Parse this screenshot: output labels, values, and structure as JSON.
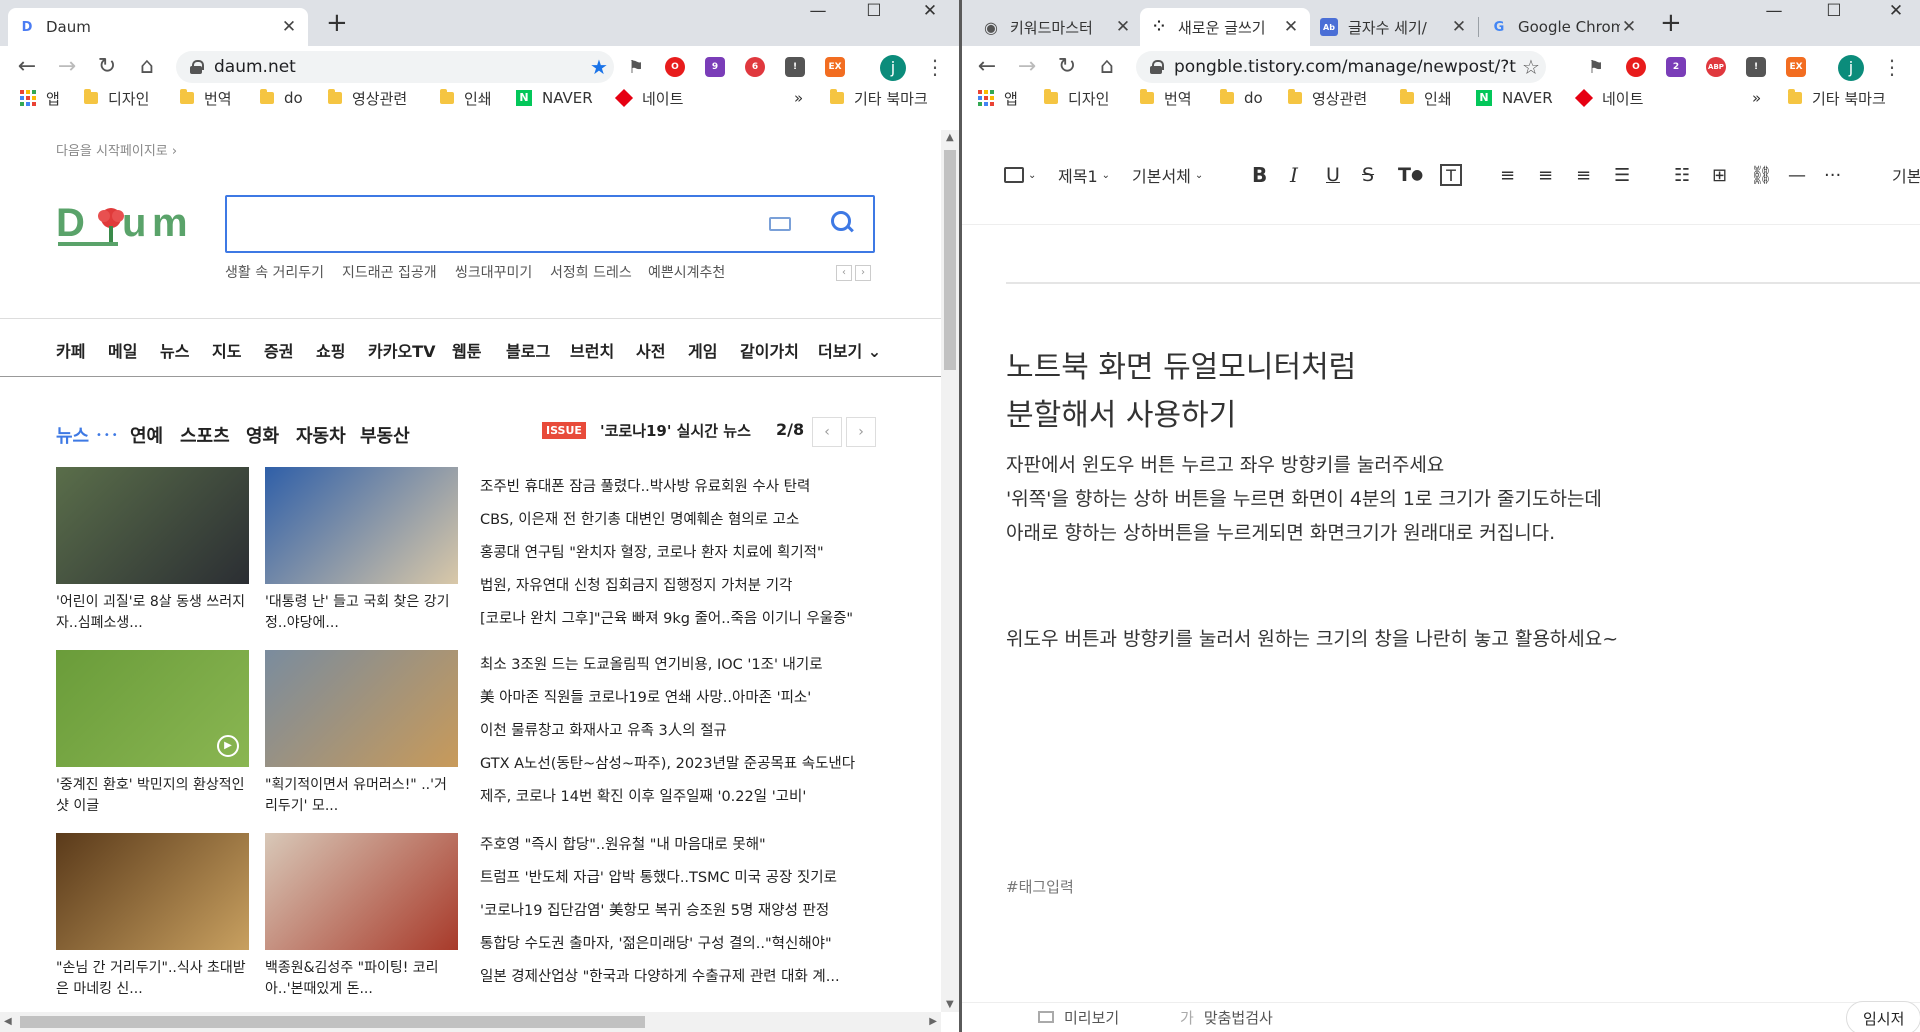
{
  "left_window": {
    "tab": {
      "title": "Daum",
      "icon": "daum-favicon"
    },
    "url": "daum.net",
    "extensions": [
      {
        "name": "opera-icon",
        "color": "#e81c1c",
        "badge": ""
      },
      {
        "name": "onenote-clip-icon",
        "color": "#7a3db8",
        "badge": "9"
      },
      {
        "name": "adblock-icon",
        "color": "#e0383e",
        "badge": "6"
      },
      {
        "name": "reader-icon",
        "color": "#555555",
        "badge": ""
      },
      {
        "name": "extension-ex-icon",
        "color": "#f26d21",
        "badge": ""
      }
    ],
    "profile": "j",
    "bookmarks": {
      "apps": "앱",
      "items": [
        "디자인",
        "번역",
        "do",
        "영상관련",
        "인쇄",
        "NAVER",
        "네이트"
      ],
      "more": "»",
      "other": "기타 북마크"
    },
    "page": {
      "startpage_link": "다음을 시작페이지로 ›",
      "logo_text": "Daum",
      "search": {
        "value": "",
        "placeholder": ""
      },
      "keywords": [
        "생활 속 거리두기",
        "지드래곤 집공개",
        "씽크대꾸미기",
        "서정희 드레스",
        "예쁜시계추천"
      ],
      "menu": [
        "카페",
        "메일",
        "뉴스",
        "지도",
        "증권",
        "쇼핑",
        "카카오TV",
        "웹툰",
        "블로그",
        "브런치",
        "사전",
        "게임",
        "같이가치",
        "더보기 ⌄"
      ],
      "news_tabs": [
        "뉴스",
        "연예",
        "스포츠",
        "영화",
        "자동차",
        "부동산"
      ],
      "issue": {
        "badge": "ISSUE",
        "title": "'코로나19' 실시간 뉴스",
        "page": "2/8"
      },
      "cards": [
        {
          "caption": "'어린이 괴질'로 8살 동생 쓰러지자..심폐소생...",
          "color1": "#5a6e4a",
          "color2": "#2b2e33"
        },
        {
          "caption": "'대통령 난' 들고 국회 찾은 강기정..야당에...",
          "color1": "#2f5fa8",
          "color2": "#d9c8a8"
        },
        {
          "caption": "'중계진 환호' 박민지의 환상적인 샷 이글",
          "color1": "#6a9c3a",
          "color2": "#8ab652"
        },
        {
          "caption": "\"획기적이면서 유머러스!\" ..'거리두기' 모...",
          "color1": "#7a8c9e",
          "color2": "#c89a5a"
        },
        {
          "caption": "\"손님 간 거리두기\"..식사 초대받은 마네킹 신...",
          "color1": "#5a3a1a",
          "color2": "#c8a060"
        },
        {
          "caption": "백종원&김성주 \"파이팅! 코리아..'본때있게 돈...",
          "color1": "#d8c8b8",
          "color2": "#a83a2a"
        }
      ],
      "headlines": [
        "조주빈 휴대폰 잠금 풀렸다..박사방 유료회원 수사 탄력",
        "CBS, 이은재 전 한기총 대변인 명예훼손 혐의로 고소",
        "홍콩대 연구팀 \"완치자 혈장, 코로나 환자 치료에 획기적\"",
        "법원, 자유연대 신청 집회금지 집행정지 가처분 기각",
        "[코로나 완치 그후]\"근육 빠져 9kg 줄어..죽음 이기니 우울증\"",
        "최소 3조원 드는 도쿄올림픽 연기비용, IOC '1조' 내기로",
        "美 아마존 직원들 코로나19로 연쇄 사망..아마존 '피소'",
        "이천 물류창고 화재사고 유족 3人의 절규",
        "GTX A노선(동탄~삼성~파주), 2023년말 준공목표 속도낸다",
        "제주, 코로나 14번 확진 이후 일주일째 '0.22일 '고비'",
        "주호영 \"즉시 합당\"..원유철 \"내 마음대로 못해\"",
        "트럼프 '반도체 자급' 압박 통했다..TSMC 미국 공장 짓기로",
        "'코로나19 집단감염' 美항모 복귀 승조원 5명 재양성 판정",
        "통합당 수도권 출마자, '젊은미래당' 구성 결의..\"혁신해야\"",
        "일본 경제산업상 \"한국과 다양하게 수출규제 관련 대화 계..."
      ]
    }
  },
  "right_window": {
    "tabs": [
      {
        "title": "키워드마스터",
        "icon": "globe-icon"
      },
      {
        "title": "새로운 글쓰기",
        "icon": "tistory-icon"
      },
      {
        "title": "글자수 세기/",
        "icon": "counter-icon"
      },
      {
        "title": "Google Chrome",
        "icon": "google-icon"
      }
    ],
    "url": "pongble.tistory.com/manage/newpost/?t...",
    "profile": "j",
    "extensions": [
      {
        "name": "opera-icon",
        "color": "#e81c1c",
        "badge": ""
      },
      {
        "name": "onenote-clip-icon",
        "color": "#7a3db8",
        "badge": "2"
      },
      {
        "name": "adblock-icon",
        "color": "#e0383e",
        "badge": ""
      },
      {
        "name": "reader-icon",
        "color": "#555555",
        "badge": ""
      },
      {
        "name": "extension-ex-icon",
        "color": "#f26d21",
        "badge": ""
      }
    ],
    "bookmarks": {
      "apps": "앱",
      "items": [
        "디자인",
        "번역",
        "do",
        "영상관련",
        "인쇄",
        "NAVER",
        "네이트"
      ],
      "more": "»",
      "other": "기타 북마크"
    },
    "editor": {
      "toolbar": {
        "heading": "제목1",
        "font": "기본서체",
        "more": "···",
        "right_label": "기본"
      },
      "title_line1": "노트북 화면 듀얼모니터처럼",
      "title_line2": "분할해서 사용하기",
      "body": [
        "자판에서 윈도우 버튼 누르고 좌우 방향키를 눌러주세요",
        "'위쪽'을 향하는 상하 버튼을 누르면 화면이 4분의 1로 크기가 줄기도하는데",
        "아래로 향하는 상하버튼을 누르게되면 화면크기가 원래대로 커집니다.",
        "위도우 버튼과 방향키를 눌러서 원하는 크기의 창을 나란히 놓고 활용하세요~"
      ],
      "tag_placeholder": "#태그입력",
      "bottom": {
        "preview": "미리보기",
        "spellcheck": "맞춤법검사",
        "save": "임시저"
      }
    }
  }
}
